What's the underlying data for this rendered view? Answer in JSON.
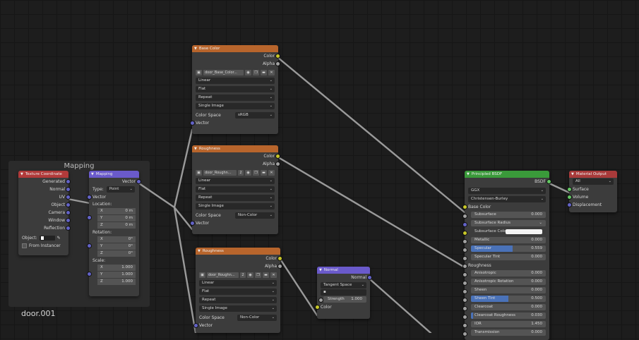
{
  "frame": {
    "title": "Mapping",
    "label": "door.001"
  },
  "tex_coord": {
    "title": "Texture Coordinate",
    "outputs": [
      "Generated",
      "Normal",
      "UV",
      "Object",
      "Camera",
      "Window",
      "Reflection"
    ],
    "object_label": "Object:",
    "from_instancer": "From Instancer"
  },
  "mapping": {
    "title": "Mapping",
    "output": "Vector",
    "type_label": "Type:",
    "type_value": "Point",
    "vector_input": "Vector",
    "location_label": "Location:",
    "location": [
      {
        "axis": "X",
        "value": "0 m"
      },
      {
        "axis": "Y",
        "value": "0 m"
      },
      {
        "axis": "Z",
        "value": "0 m"
      }
    ],
    "rotation_label": "Rotation:",
    "rotation": [
      {
        "axis": "X",
        "value": "0°"
      },
      {
        "axis": "Y",
        "value": "0°"
      },
      {
        "axis": "Z",
        "value": "0°"
      }
    ],
    "scale_label": "Scale:",
    "scale": [
      {
        "axis": "X",
        "value": "1.000"
      },
      {
        "axis": "Y",
        "value": "1.000"
      },
      {
        "axis": "Z",
        "value": "1.000"
      }
    ]
  },
  "image_nodes": [
    {
      "title": "Base Color",
      "outputs": [
        "Color",
        "Alpha"
      ],
      "image": "door_Base_Color...",
      "users": "",
      "interpolation": "Linear",
      "projection": "Flat",
      "extension": "Repeat",
      "source": "Single Image",
      "colorspace_label": "Color Space",
      "colorspace": "sRGB",
      "input": "Vector"
    },
    {
      "title": "Roughness",
      "outputs": [
        "Color",
        "Alpha"
      ],
      "image": "door_Roughn...",
      "users": "2",
      "interpolation": "Linear",
      "projection": "Flat",
      "extension": "Repeat",
      "source": "Single Image",
      "colorspace_label": "Color Space",
      "colorspace": "Non-Color",
      "input": "Vector"
    },
    {
      "title": "Roughness",
      "outputs": [
        "Color",
        "Alpha"
      ],
      "image": "door_Roughn...",
      "users": "2",
      "interpolation": "Linear",
      "projection": "Flat",
      "extension": "Repeat",
      "source": "Single Image",
      "colorspace_label": "Color Space",
      "colorspace": "Non-Color",
      "input": "Vector"
    }
  ],
  "normal_map": {
    "title": "Normal",
    "output": "Normal",
    "space": "Tangent Space",
    "uv": "",
    "strength_label": "Strength",
    "strength_value": "1.000",
    "input": "Color"
  },
  "bsdf": {
    "title": "Principled BSDF",
    "output": "BSDF",
    "distribution": "GGX",
    "subsurface_method": "Christensen-Burley",
    "base_color": "Base Color",
    "sliders": [
      {
        "label": "Subsurface",
        "value": "0.000",
        "fill": 0.0,
        "sock": "gry"
      },
      {
        "label": "Subsurface Radius",
        "value": "",
        "fill": 0.0,
        "sock": "pur",
        "dropdown": true
      },
      {
        "label": "Subsurface Color",
        "value": "",
        "fill": 0.0,
        "sock": "yel",
        "color": true
      },
      {
        "label": "Metallic",
        "value": "0.000",
        "fill": 0.0,
        "sock": "gry"
      },
      {
        "label": "Specular",
        "value": "0.559",
        "fill": 0.559,
        "sock": "gry"
      },
      {
        "label": "Specular Tint",
        "value": "0.000",
        "fill": 0.0,
        "sock": "gry"
      },
      {
        "label": "Roughness",
        "value": "",
        "fill": 0.0,
        "sock": "gry",
        "plain": true
      },
      {
        "label": "Anisotropic",
        "value": "0.000",
        "fill": 0.0,
        "sock": "gry"
      },
      {
        "label": "Anisotropic Rotation",
        "value": "0.000",
        "fill": 0.0,
        "sock": "gry"
      },
      {
        "label": "Sheen",
        "value": "0.000",
        "fill": 0.0,
        "sock": "gry"
      },
      {
        "label": "Sheen Tint",
        "value": "0.500",
        "fill": 0.5,
        "sock": "gry"
      },
      {
        "label": "Clearcoat",
        "value": "0.000",
        "fill": 0.0,
        "sock": "gry"
      },
      {
        "label": "Clearcoat Roughness",
        "value": "0.030",
        "fill": 0.03,
        "sock": "gry"
      },
      {
        "label": "IOR",
        "value": "1.450",
        "fill": 0.0,
        "sock": "gry"
      },
      {
        "label": "Transmission",
        "value": "0.000",
        "fill": 0.0,
        "sock": "gry"
      }
    ]
  },
  "output_node": {
    "title": "Material Output",
    "target": "All",
    "inputs": [
      "Surface",
      "Volume",
      "Displacement"
    ]
  },
  "colors": {
    "image_header": "#b8652c",
    "vector_header": "#6a5acb",
    "shader_header": "#3a9a3a",
    "output_header": "#a83a3a",
    "color_socket": "#c7c729",
    "float_socket": "#a1a1a1",
    "vector_socket": "#6363c7",
    "shader_socket": "#63c763"
  }
}
